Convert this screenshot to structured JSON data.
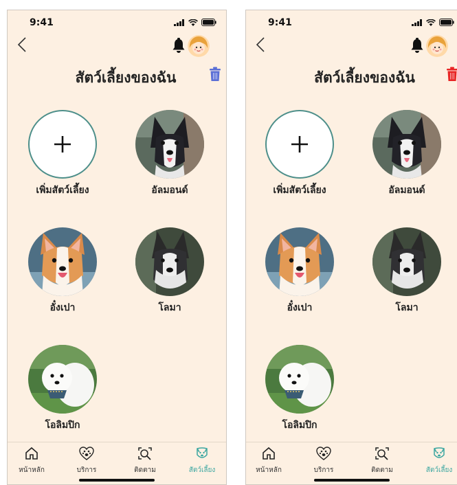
{
  "status_bar": {
    "time": "9:41"
  },
  "header": {
    "title": "สัตว์เลี้ยงของฉัน"
  },
  "pets": {
    "add_label": "เพิ่มสัตว์เลี้ยง",
    "items": [
      {
        "name": "อัลมอนด์"
      },
      {
        "name": "อั๋งเปา"
      },
      {
        "name": "โลมา"
      },
      {
        "name": "โอลิมปิก"
      }
    ]
  },
  "tabs": [
    {
      "label": "หน้าหลัก",
      "icon": "home-icon"
    },
    {
      "label": "บริการ",
      "icon": "paw-heart-icon"
    },
    {
      "label": "ติดตาม",
      "icon": "track-search-icon"
    },
    {
      "label": "สัตว์เลี้ยง",
      "icon": "pet-icon",
      "active": true
    }
  ],
  "colors": {
    "background": "#fdf0e2",
    "accent": "#3aa6a0",
    "trash_left": "#5b6fd6",
    "trash_right": "#e82525"
  }
}
